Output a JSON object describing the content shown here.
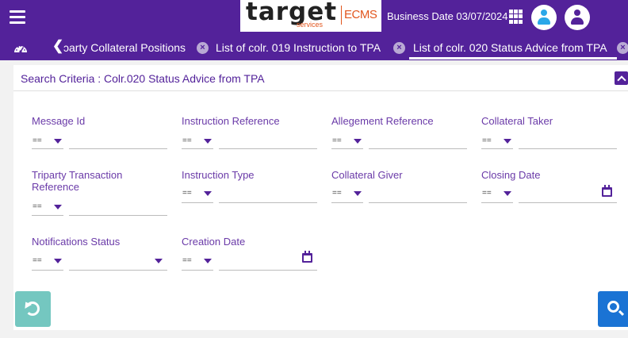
{
  "header": {
    "logo_text": "target",
    "logo_subtext": "services",
    "logo_product": "ECMS",
    "business_date": "Business Date 03/07/2024",
    "icons": [
      "menu-icon",
      "apps-grid-icon",
      "user-icon",
      "user-profile-icon"
    ]
  },
  "tabs": [
    {
      "label": "ɔarty Collateral Positions",
      "closable": true
    },
    {
      "label": "List of colr. 019 Instruction to TPA",
      "closable": true
    },
    {
      "label": "List of colr. 020 Status Advice from TPA",
      "closable": true,
      "active": true
    }
  ],
  "search": {
    "title": "Search Criteria : Colr.020 Status Advice from TPA",
    "operator": "==",
    "fields": {
      "message_id": "Message Id",
      "instruction_reference": "Instruction Reference",
      "allegement_reference": "Allegement Reference",
      "collateral_taker": "Collateral Taker",
      "triparty_transaction_reference": "Triparty Transaction Reference",
      "instruction_type": "Instruction Type",
      "collateral_giver": "Collateral Giver",
      "closing_date": "Closing Date",
      "notifications_status": "Notifications Status",
      "creation_date": "Creation Date"
    },
    "values": {
      "message_id": "",
      "instruction_reference": "",
      "allegement_reference": "",
      "collateral_taker": "",
      "triparty_transaction_reference": "",
      "instruction_type": "",
      "collateral_giver": "",
      "closing_date": "",
      "notifications_status": "",
      "creation_date": ""
    }
  },
  "colors": {
    "brand": "#53229a",
    "reset": "#74c7c0",
    "search": "#1a73d4"
  }
}
